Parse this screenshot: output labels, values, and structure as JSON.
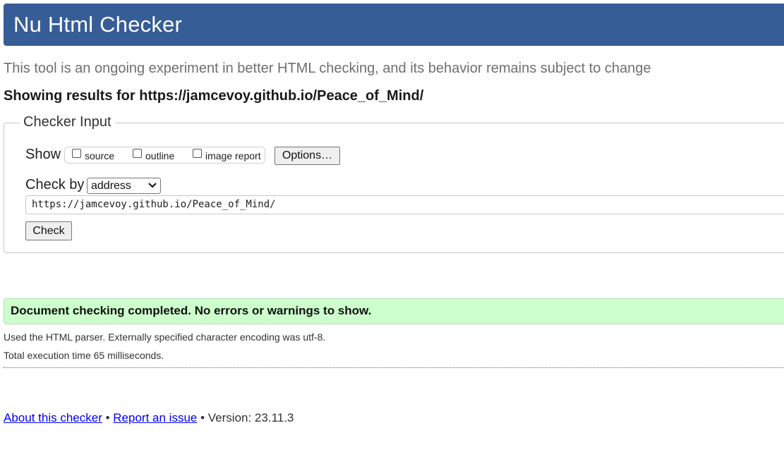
{
  "header": {
    "title": "Nu Html Checker"
  },
  "intro": "This tool is an ongoing experiment in better HTML checking, and its behavior remains subject to change",
  "results_for": "Showing results for https://jamcevoy.github.io/Peace_of_Mind/",
  "checker_input": {
    "legend": "Checker Input",
    "show_label": "Show",
    "show_options": [
      {
        "label": "source",
        "checked": false
      },
      {
        "label": "outline",
        "checked": false
      },
      {
        "label": "image report",
        "checked": false
      }
    ],
    "options_button": "Options…",
    "check_by_label": "Check by",
    "check_by_value": "address",
    "url_value": "https://jamcevoy.github.io/Peace_of_Mind/",
    "check_button": "Check"
  },
  "result": {
    "message": "Document checking completed. No errors or warnings to show.",
    "parser_info": "Used the HTML parser. Externally specified character encoding was utf-8.",
    "execution_time": "Total execution time 65 milliseconds."
  },
  "footer": {
    "about_link": "About this checker",
    "separator": "•",
    "report_link": "Report an issue",
    "version": "Version: 23.11.3"
  },
  "colors": {
    "header_bg": "#365d95",
    "success_bg": "#ccffcc",
    "link": "#0000ee"
  }
}
